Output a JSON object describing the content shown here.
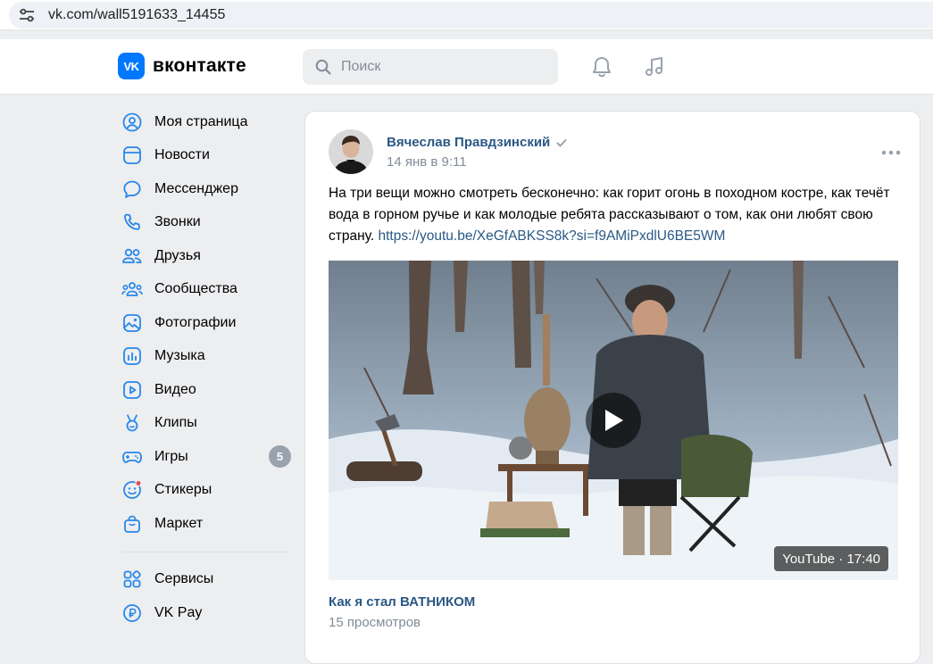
{
  "browser": {
    "url": "vk.com/wall5191633_14455",
    "site_info_icon": "tune-icon"
  },
  "header": {
    "logo_badge": "VK",
    "logo_text": "вконтакте",
    "search_placeholder": "Поиск",
    "icons": [
      "bell-icon",
      "music-note-icon"
    ]
  },
  "sidebar": {
    "items": [
      {
        "label": "Моя страница",
        "icon": "user-circle-icon"
      },
      {
        "label": "Новости",
        "icon": "news-icon"
      },
      {
        "label": "Мессенджер",
        "icon": "message-icon"
      },
      {
        "label": "Звонки",
        "icon": "phone-icon"
      },
      {
        "label": "Друзья",
        "icon": "friends-icon"
      },
      {
        "label": "Сообщества",
        "icon": "communities-icon"
      },
      {
        "label": "Фотографии",
        "icon": "photos-icon"
      },
      {
        "label": "Музыка",
        "icon": "music-icon"
      },
      {
        "label": "Видео",
        "icon": "video-icon"
      },
      {
        "label": "Клипы",
        "icon": "clips-icon"
      },
      {
        "label": "Игры",
        "icon": "gamepad-icon",
        "badge": "5"
      },
      {
        "label": "Стикеры",
        "icon": "stickers-icon"
      },
      {
        "label": "Маркет",
        "icon": "market-bag-icon"
      }
    ],
    "bottom_items": [
      {
        "label": "Сервисы",
        "icon": "services-grid-icon"
      },
      {
        "label": "VK Pay",
        "icon": "vkpay-icon"
      }
    ]
  },
  "post": {
    "author": "Вячеслав Правдзинский",
    "date": "14 янв в 9:11",
    "text": "На три вещи можно смотреть бесконечно: как горит огонь в походном костре, как течёт вода в горном ручье и как молодые ребята рассказывают о том, как они любят свою страну. ",
    "link": "https://youtu.be/XeGfABKSS8k?si=f9AMiPxdlU6BE5WM",
    "video": {
      "duration_badge": "YouTube · 17:40",
      "title": "Как я стал ВАТНИКОМ",
      "views": "15 просмотров"
    }
  },
  "colors": {
    "accent": "#0077ff",
    "link": "#2a5885",
    "secondary_text": "#818c99",
    "page_bg": "#edeef0"
  }
}
